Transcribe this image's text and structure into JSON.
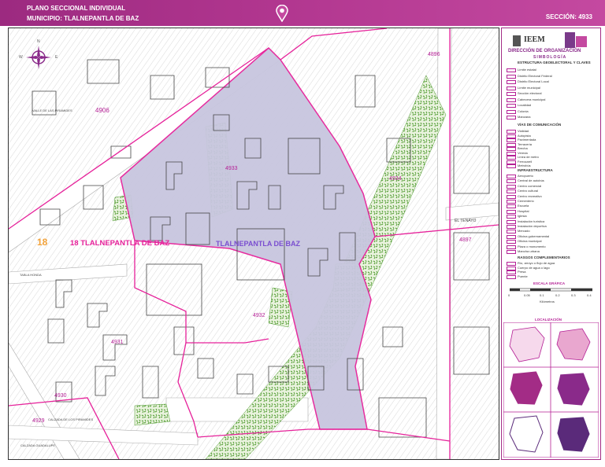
{
  "header": {
    "title": "PLANO SECCIONAL INDIVIDUAL",
    "municipality": "MUNICIPIO: TLALNEPANTLA DE BAZ",
    "section": "SECCIÓN: 4933"
  },
  "map": {
    "district_label": "18 TLALNEPANTLA DE BAZ",
    "district_number": "18",
    "municipality_label": "TLALNEPANTLA DE BAZ",
    "sections": [
      "4906",
      "4896",
      "4933",
      "4934",
      "4897",
      "4932",
      "4931",
      "4930",
      "4929"
    ],
    "street_labels": [
      "VALLE DE LAS PIRAMIDES",
      "EL TENAYO",
      "TABLA HONDA",
      "CALZADA DE LOS PIRAMIDES",
      "CALZADA GUADALUPE"
    ],
    "compass": {
      "n": "N",
      "s": "S",
      "e": "E",
      "w": "W"
    },
    "colors": {
      "selected": "#c8c6df",
      "boundary": "#e6219a",
      "green": "#66a63b",
      "hatch": "#d7d7d7",
      "block": "#555555",
      "labels": "#b41f95",
      "district": "#e6219a",
      "district_number": "#f2a23a"
    }
  },
  "legend": {
    "org": "IEEM",
    "title": "DIRECCIÓN DE ORGANIZACIÓN",
    "subtitle": "SIMBOLOGÍA",
    "group1": "ESTRUCTURA GEOELECTORAL Y CLAVES",
    "items1": [
      "Límite estatal",
      "Distrito Electoral Federal",
      "Distrito Electoral Local",
      "Límite municipal",
      "Sección electoral",
      "Cabecera municipal",
      "Localidad",
      "Colonia",
      "Manzana"
    ],
    "group2": "VÍAS DE COMUNICACIÓN",
    "items2": [
      "Vialidad",
      "Autopista",
      "Pavimentada",
      "Terracería",
      "Brecha",
      "Vereda",
      "Línea de metro",
      "Ferrocarril",
      "Metrobús"
    ],
    "group3": "INFRAESTRUCTURA",
    "items3": [
      "Aeropuerto",
      "Central de autobús",
      "Centro comercial",
      "Centro cultural",
      "Centro recreativo",
      "Cementerio",
      "Escuela",
      "Hospital",
      "Iglesia",
      "Instalación turística",
      "Instalación deportiva",
      "Mercado",
      "Oficina gubernamental",
      "Oficina municipal",
      "Plaza o monumento",
      "Mancha urbana"
    ],
    "group4": "RASGOS COMPLEMENTARIOS",
    "items4": [
      "Río, arroyo o flujo de agua",
      "Cuerpo de agua o lago",
      "Presa",
      "Puente"
    ],
    "scale_title": "ESCALA GRÁFICA",
    "scale_ticks": [
      "0",
      "0.05",
      "0.1",
      "0.2",
      "0.3",
      "0.4"
    ],
    "units": "Kilómetros",
    "locator_title": "LOCALIZACIÓN"
  }
}
